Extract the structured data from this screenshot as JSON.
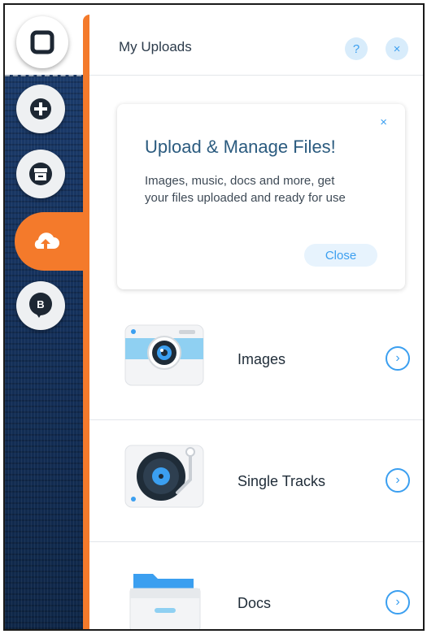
{
  "panel": {
    "title": "My Uploads",
    "help_label": "?",
    "close_label": "×"
  },
  "promo": {
    "title": "Upload & Manage Files!",
    "text": "Images, music, docs and more, get your files uploaded and ready for use",
    "dismiss_label": "×",
    "close_label": "Close"
  },
  "categories": [
    {
      "label": "Images",
      "icon": "camera-icon",
      "arrow": "›"
    },
    {
      "label": "Single Tracks",
      "icon": "vinyl-record-icon",
      "arrow": "›"
    },
    {
      "label": "Docs",
      "icon": "file-drawer-icon",
      "arrow": "›"
    }
  ],
  "leftbar": {
    "blog_badge": "B",
    "items": [
      "home-icon",
      "add-icon",
      "store-icon",
      "upload-icon",
      "blog-icon"
    ]
  },
  "colors": {
    "accent_orange": "#f47a2b",
    "accent_blue": "#3b9ff0",
    "sidebar_navy": "#15325d"
  }
}
